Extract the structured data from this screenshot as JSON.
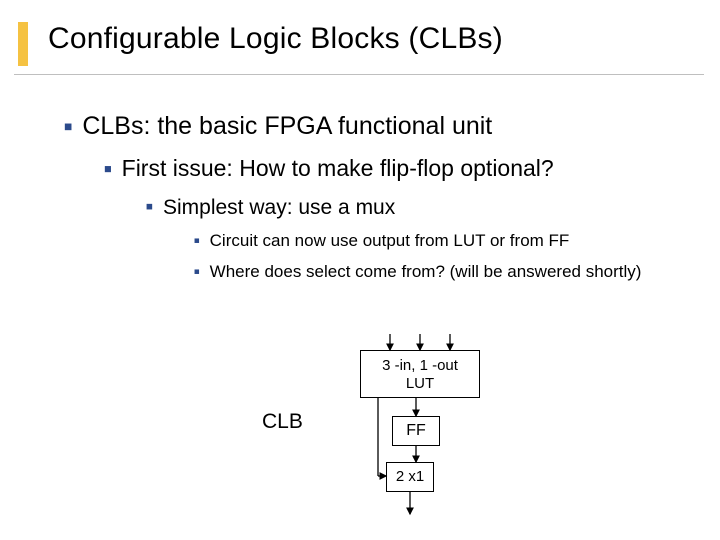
{
  "title": "Configurable Logic Blocks (CLBs)",
  "bullets": {
    "l1": "CLBs: the basic FPGA functional unit",
    "l2": "First issue: How to make flip-flop optional?",
    "l3": "Simplest way: use a mux",
    "l4a": "Circuit can now use output from LUT or from FF",
    "l4b": "Where does select come from? (will be answered shortly)"
  },
  "diagram": {
    "clb_label": "CLB",
    "lut_line1": "3 -in, 1 -out",
    "lut_line2": "LUT",
    "ff": "FF",
    "mux": "2 x1"
  }
}
